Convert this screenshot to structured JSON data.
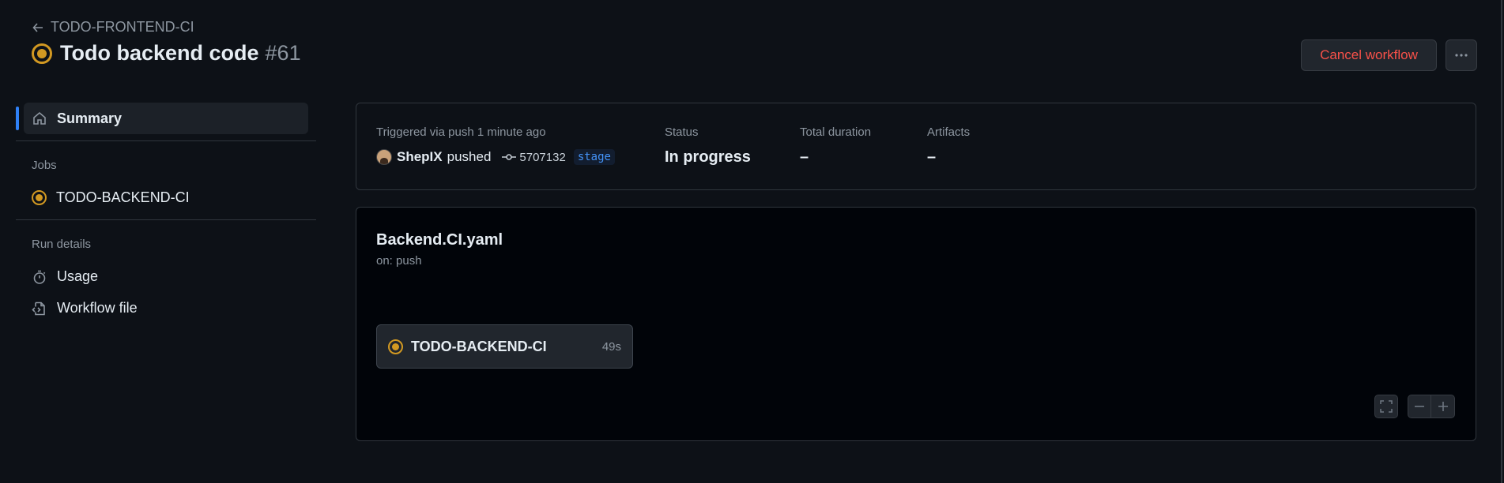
{
  "header": {
    "back_label": "TODO-FRONTEND-CI",
    "title": "Todo backend code",
    "run_number": "#61",
    "cancel_label": "Cancel workflow"
  },
  "sidebar": {
    "summary_label": "Summary",
    "jobs_heading": "Jobs",
    "jobs": [
      {
        "label": "TODO-BACKEND-CI",
        "status": "in-progress"
      }
    ],
    "run_details_heading": "Run details",
    "details": [
      {
        "label": "Usage",
        "icon": "stopwatch-icon"
      },
      {
        "label": "Workflow file",
        "icon": "file-code-icon"
      }
    ]
  },
  "summary": {
    "trigger_text": "Triggered via push 1 minute ago",
    "actor": "ShepIX",
    "action": "pushed",
    "commit_sha": "5707132",
    "branch": "stage",
    "status_label": "Status",
    "status_value": "In progress",
    "duration_label": "Total duration",
    "duration_value": "–",
    "artifacts_label": "Artifacts",
    "artifacts_value": "–"
  },
  "workflow": {
    "file_name": "Backend.CI.yaml",
    "trigger": "on: push",
    "job_name": "TODO-BACKEND-CI",
    "job_duration": "49s"
  },
  "colors": {
    "in_progress": "#d29922",
    "accent": "#2f81f7",
    "danger": "#f85149",
    "background": "#0d1117"
  }
}
